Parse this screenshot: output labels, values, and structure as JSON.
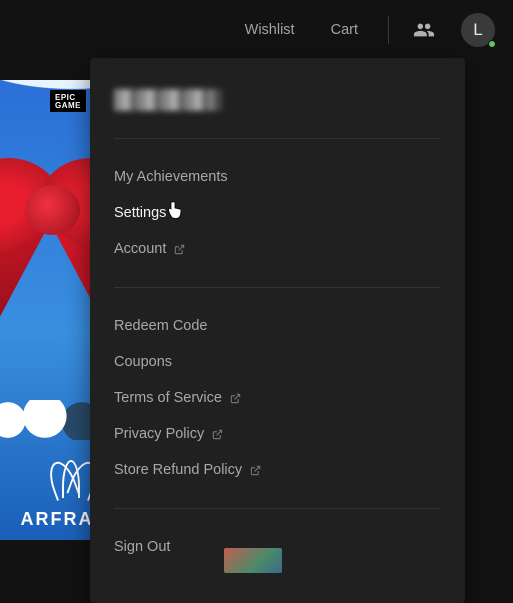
{
  "topbar": {
    "wishlist": "Wishlist",
    "cart": "Cart",
    "avatar_initial": "L"
  },
  "card": {
    "brand": "EPIC",
    "brand2": "GAME",
    "title": "ARFRAME"
  },
  "dropdown": {
    "group1": [
      {
        "label": "My Achievements",
        "external": false
      },
      {
        "label": "Settings",
        "external": false,
        "highlight": true
      },
      {
        "label": "Account",
        "external": true
      }
    ],
    "group2": [
      {
        "label": "Redeem Code",
        "external": false
      },
      {
        "label": "Coupons",
        "external": false
      },
      {
        "label": "Terms of Service",
        "external": true
      },
      {
        "label": "Privacy Policy",
        "external": true
      },
      {
        "label": "Store Refund Policy",
        "external": true
      }
    ],
    "signout": "Sign Out"
  }
}
